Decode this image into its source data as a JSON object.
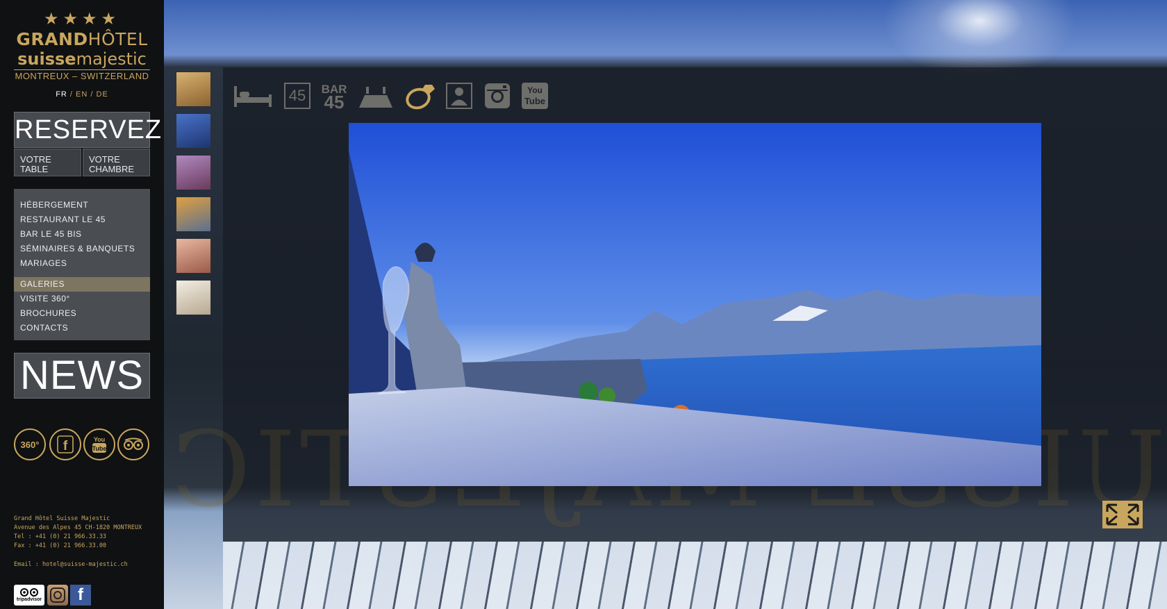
{
  "logo": {
    "stars": "★★★★",
    "line1_bold": "GRAND",
    "line1_thin": "HÔTEL",
    "line2_bold": "suisse",
    "line2_thin": "majestic",
    "line3": "MONTREUX – SWITZERLAND"
  },
  "languages": [
    {
      "label": "FR",
      "active": true
    },
    {
      "label": "EN",
      "active": false
    },
    {
      "label": "DE",
      "active": false
    }
  ],
  "lang_separator": "/",
  "reserve": {
    "title": "RESERVEZ",
    "table_label": "VOTRE TABLE",
    "room_label": "VOTRE CHAMBRE"
  },
  "menu": {
    "group1": [
      "HÉBERGEMENT",
      "RESTAURANT LE 45",
      "BAR LE 45 BIS",
      "SÉMINAIRES & BANQUETS",
      "MARIAGES"
    ],
    "group2": [
      "GALERIES",
      "VISITE 360°",
      "BROCHURES",
      "CONTACTS"
    ],
    "active": "GALERIES"
  },
  "news_label": "NEWS",
  "social_circles": [
    {
      "icon": "360-icon",
      "label": "360°"
    },
    {
      "icon": "facebook-icon",
      "label": "f"
    },
    {
      "icon": "youtube-icon",
      "label": "You Tube"
    },
    {
      "icon": "tripadvisor-icon",
      "label": "oo"
    }
  ],
  "address": {
    "name": "Grand Hôtel Suisse Majestic",
    "street": "Avenue des Alpes 45 CH-1820 MONTREUX",
    "tel": "Tel : +41 (0) 21 966.33.33",
    "fax": "Fax : +41 (0) 21 966.33.00",
    "email": "Email : hotel@suisse-majestic.ch"
  },
  "footer_icons": [
    {
      "icon": "tripadvisor-icon",
      "label": "tripadvisor"
    },
    {
      "icon": "instagram-icon",
      "label": ""
    },
    {
      "icon": "facebook-icon",
      "label": "f"
    }
  ],
  "top_icons": [
    {
      "name": "bed-icon",
      "label": ""
    },
    {
      "name": "restaurant-45-icon",
      "label": "45"
    },
    {
      "name": "bar-45-icon",
      "label_top": "BAR",
      "label_bottom": "45"
    },
    {
      "name": "seminar-table-icon",
      "label": ""
    },
    {
      "name": "wedding-ring-icon",
      "label": ""
    },
    {
      "name": "concierge-icon",
      "label": ""
    },
    {
      "name": "instagram-icon",
      "label": ""
    },
    {
      "name": "youtube-icon",
      "label_top": "You",
      "label_bottom": "Tube"
    }
  ],
  "thumbnails": [
    {
      "name": "thumb-restaurant-hall",
      "color_a": "#d8b270",
      "color_b": "#8a6230"
    },
    {
      "name": "thumb-lake-view",
      "color_a": "#4a72c8",
      "color_b": "#1d3570"
    },
    {
      "name": "thumb-purple-dining",
      "color_a": "#b08ac0",
      "color_b": "#6a3a5c"
    },
    {
      "name": "thumb-terrace",
      "color_a": "#e0a040",
      "color_b": "#5a7090"
    },
    {
      "name": "thumb-banquet-room",
      "color_a": "#e8b8a0",
      "color_b": "#9a5a48"
    },
    {
      "name": "thumb-bedroom",
      "color_a": "#f2ede4",
      "color_b": "#b8a890"
    }
  ],
  "colors": {
    "gold": "#c9a65e",
    "sidebar": "#0f1113",
    "menu_bg": "#4a4d52",
    "menu_active": "#7d7560"
  }
}
